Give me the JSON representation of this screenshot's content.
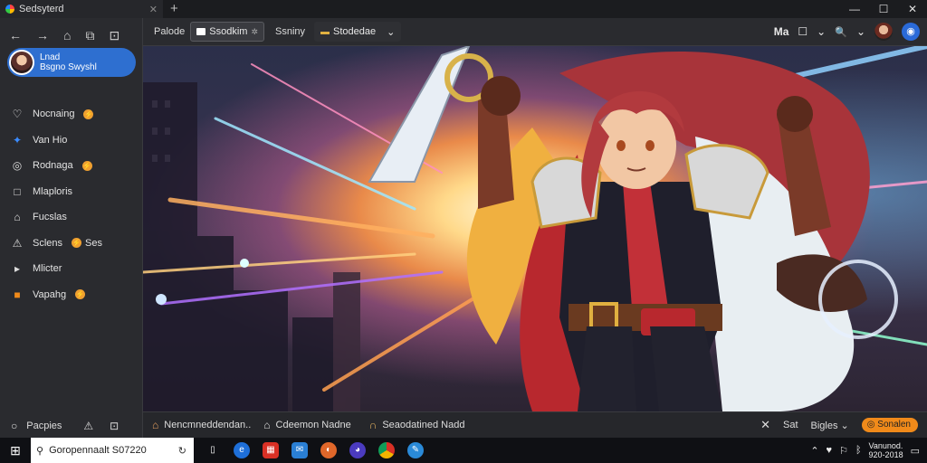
{
  "window": {
    "tab_title": "Sedsyterd",
    "tab_close": "✕",
    "new_tab": "+",
    "min": "—",
    "max": "☐",
    "close": "✕"
  },
  "sidebar": {
    "nav_icons": [
      "←",
      "→",
      "⌂",
      "⧉",
      "⊡"
    ],
    "profile": {
      "line1": "Lnad",
      "line2": "Bsgno Swyshl"
    },
    "items": [
      {
        "icon": "♡",
        "label": "Nocnaing",
        "badge": true
      },
      {
        "icon": "✦",
        "label": "Van Hio",
        "badge": false
      },
      {
        "icon": "◎",
        "label": "Rodnaga",
        "badge": true
      },
      {
        "icon": "□",
        "label": "Mlaploris",
        "badge": false
      },
      {
        "icon": "⌂",
        "label": "Fucslas",
        "badge": false
      },
      {
        "icon": "⚠",
        "label": "Sclens",
        "badge": true,
        "suffix": "Ses"
      },
      {
        "icon": "▸",
        "label": "Mlicter",
        "badge": false
      },
      {
        "icon": "■",
        "label": "Vapahg",
        "badge": true
      }
    ],
    "footer": {
      "icon": "○",
      "label": "Pacpies",
      "icon2": "⚠",
      "icon3": "⊡"
    }
  },
  "toolbar": {
    "item1": "Palode",
    "item2": "Ssodkim",
    "item2_suffix": "✲",
    "item3": "Ssniny",
    "item4": "Stodedae",
    "right_text": "Ma",
    "icons": [
      "☐",
      "⌄",
      "🔍",
      "⌄"
    ],
    "globe": "◉"
  },
  "statusbar": {
    "item1": "Nencmneddendan..",
    "item2": "Cdeemon Nadne",
    "item3": "Seaodatined Nadd",
    "close": "✕",
    "sat": "Sat",
    "bigles": "Bigles",
    "action": "Sonalen"
  },
  "taskbar": {
    "start": "⊞",
    "search_text": "Goropennaalt S07220",
    "app_colors": [
      "#1e6fd9",
      "#d93025",
      "#2a7fd4",
      "#e0672a",
      "#4b3bbf",
      "#0aa84f",
      "#2a8ad8"
    ],
    "tray_icons": [
      "⌃",
      "♥",
      "⚐",
      "ᛒ"
    ],
    "time": "Vanunod.",
    "date": "920-2018"
  },
  "colors": {
    "accent": "#2e6fd0",
    "badge": "#f0a030",
    "action": "#f08a1a"
  }
}
